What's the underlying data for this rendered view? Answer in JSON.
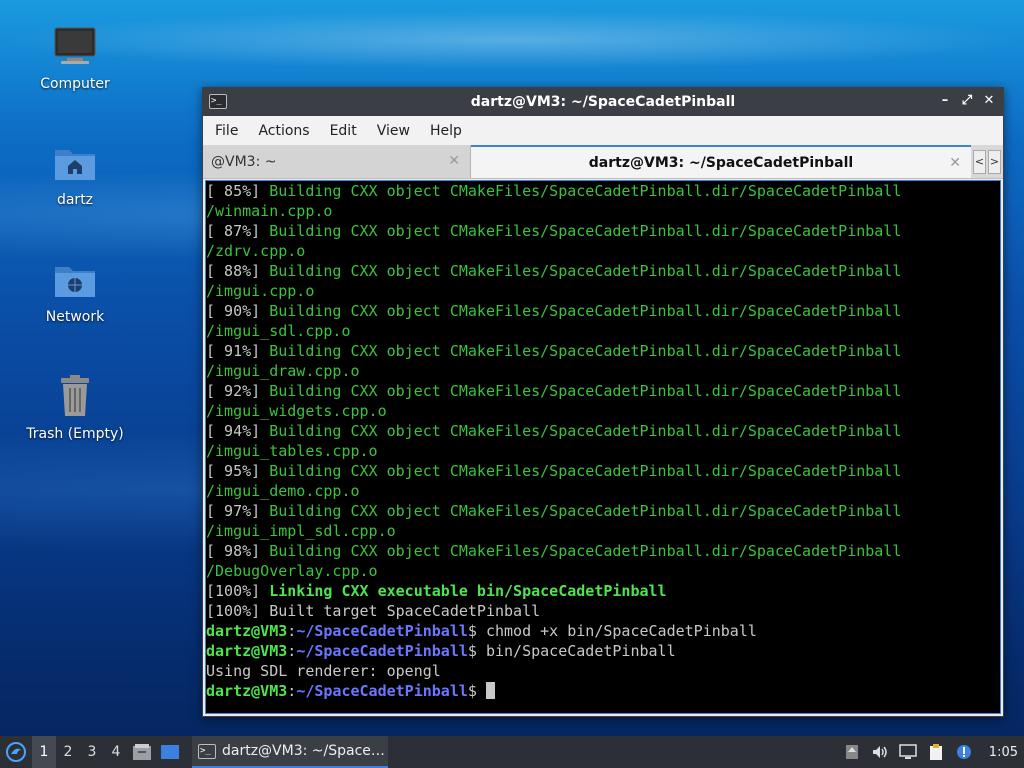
{
  "desktop": {
    "icons": [
      {
        "label": "Computer",
        "icon": "computer-icon"
      },
      {
        "label": "dartz",
        "icon": "home-folder-icon"
      },
      {
        "label": "Network",
        "icon": "network-folder-icon"
      },
      {
        "label": "Trash (Empty)",
        "icon": "trash-icon"
      }
    ]
  },
  "window": {
    "title": "dartz@VM3: ~/SpaceCadetPinball",
    "controls": {
      "minimize": "–",
      "maximize": "⤢",
      "close": "✕"
    },
    "menu": [
      "File",
      "Actions",
      "Edit",
      "View",
      "Help"
    ],
    "tabs": [
      {
        "label": "@VM3: ~",
        "active": false
      },
      {
        "label": "dartz@VM3: ~/SpaceCadetPinball",
        "active": true
      }
    ],
    "tab_close": "✕",
    "tab_nav": {
      "prev": "<",
      "next": ">"
    }
  },
  "terminal": {
    "build_lines": [
      {
        "pct": "[ 85%] ",
        "msg": "Building CXX object CMakeFiles/SpaceCadetPinball.dir/SpaceCadetPinball",
        "cont": "/winmain.cpp.o"
      },
      {
        "pct": "[ 87%] ",
        "msg": "Building CXX object CMakeFiles/SpaceCadetPinball.dir/SpaceCadetPinball",
        "cont": "/zdrv.cpp.o"
      },
      {
        "pct": "[ 88%] ",
        "msg": "Building CXX object CMakeFiles/SpaceCadetPinball.dir/SpaceCadetPinball",
        "cont": "/imgui.cpp.o"
      },
      {
        "pct": "[ 90%] ",
        "msg": "Building CXX object CMakeFiles/SpaceCadetPinball.dir/SpaceCadetPinball",
        "cont": "/imgui_sdl.cpp.o"
      },
      {
        "pct": "[ 91%] ",
        "msg": "Building CXX object CMakeFiles/SpaceCadetPinball.dir/SpaceCadetPinball",
        "cont": "/imgui_draw.cpp.o"
      },
      {
        "pct": "[ 92%] ",
        "msg": "Building CXX object CMakeFiles/SpaceCadetPinball.dir/SpaceCadetPinball",
        "cont": "/imgui_widgets.cpp.o"
      },
      {
        "pct": "[ 94%] ",
        "msg": "Building CXX object CMakeFiles/SpaceCadetPinball.dir/SpaceCadetPinball",
        "cont": "/imgui_tables.cpp.o"
      },
      {
        "pct": "[ 95%] ",
        "msg": "Building CXX object CMakeFiles/SpaceCadetPinball.dir/SpaceCadetPinball",
        "cont": "/imgui_demo.cpp.o"
      },
      {
        "pct": "[ 97%] ",
        "msg": "Building CXX object CMakeFiles/SpaceCadetPinball.dir/SpaceCadetPinball",
        "cont": "/imgui_impl_sdl.cpp.o"
      },
      {
        "pct": "[ 98%] ",
        "msg": "Building CXX object CMakeFiles/SpaceCadetPinball.dir/SpaceCadetPinball",
        "cont": "/DebugOverlay.cpp.o"
      }
    ],
    "link_pct": "[100%] ",
    "link_msg": "Linking CXX executable bin/SpaceCadetPinball",
    "built_line": "[100%] Built target SpaceCadetPinball",
    "prompt_user": "dartz@VM3",
    "prompt_sep": ":",
    "prompt_path": "~/SpaceCadetPinball",
    "prompt_end": "$ ",
    "cmd1": "chmod +x bin/SpaceCadetPinball",
    "cmd2": "bin/SpaceCadetPinball",
    "output1": "Using SDL renderer: opengl"
  },
  "taskbar": {
    "workspaces": [
      "1",
      "2",
      "3",
      "4"
    ],
    "active_workspace": "1",
    "task_label": "dartz@VM3: ~/Space…",
    "clock": "1:05"
  },
  "colors": {
    "accent": "#3b82e0",
    "term_green": "#3cc23c",
    "prompt_path": "#6a78ff"
  }
}
